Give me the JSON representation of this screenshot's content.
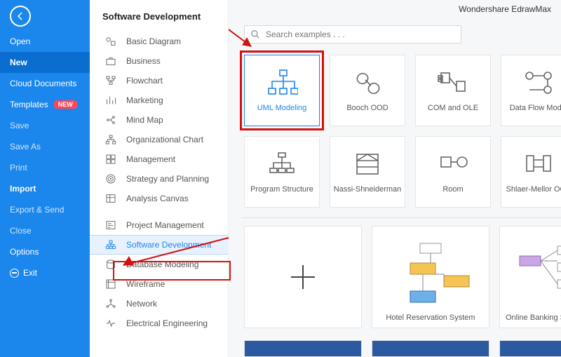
{
  "brand": "Wondershare EdrawMax",
  "nav": {
    "items": [
      {
        "label": "Open",
        "cls": ""
      },
      {
        "label": "New",
        "cls": "active"
      },
      {
        "label": "Cloud Documents",
        "cls": ""
      },
      {
        "label": "Templates",
        "cls": "",
        "badge": "NEW"
      },
      {
        "label": "Save",
        "cls": "dim"
      },
      {
        "label": "Save As",
        "cls": "dim"
      },
      {
        "label": "Print",
        "cls": "dim"
      },
      {
        "label": "Import",
        "cls": "bold"
      },
      {
        "label": "Export & Send",
        "cls": "dim"
      },
      {
        "label": "Close",
        "cls": "dim"
      },
      {
        "label": "Options",
        "cls": ""
      },
      {
        "label": "Exit",
        "cls": "",
        "icon": "minus"
      }
    ]
  },
  "crumb": "Software Development",
  "categories_top": [
    {
      "label": "Basic Diagram",
      "icon": "shapes"
    },
    {
      "label": "Business",
      "icon": "briefcase"
    },
    {
      "label": "Flowchart",
      "icon": "flow"
    },
    {
      "label": "Marketing",
      "icon": "bars"
    },
    {
      "label": "Mind Map",
      "icon": "mind"
    },
    {
      "label": "Organizational Chart",
      "icon": "org"
    },
    {
      "label": "Management",
      "icon": "grid"
    },
    {
      "label": "Strategy and Planning",
      "icon": "target"
    },
    {
      "label": "Analysis Canvas",
      "icon": "canvas"
    }
  ],
  "categories_bottom": [
    {
      "label": "Project Management",
      "icon": "gantt"
    },
    {
      "label": "Software Development",
      "icon": "uml",
      "selected": true
    },
    {
      "label": "Database Modeling",
      "icon": "db"
    },
    {
      "label": "Wireframe",
      "icon": "wire"
    },
    {
      "label": "Network",
      "icon": "net"
    },
    {
      "label": "Electrical Engineering",
      "icon": "ee"
    }
  ],
  "search": {
    "placeholder": "Search examples . . ."
  },
  "tiles": [
    {
      "label": "UML Modeling",
      "selected": true
    },
    {
      "label": "Booch OOD"
    },
    {
      "label": "COM and OLE"
    },
    {
      "label": "Data Flow Model"
    },
    {
      "label": "Program Structure"
    },
    {
      "label": "Nassi-Shneiderman"
    },
    {
      "label": "Room"
    },
    {
      "label": "Shlaer-Mellor OOA"
    }
  ],
  "templates": [
    {
      "label": ""
    },
    {
      "label": "Hotel Reservation System"
    },
    {
      "label": "Online Banking Sms Customer"
    }
  ]
}
